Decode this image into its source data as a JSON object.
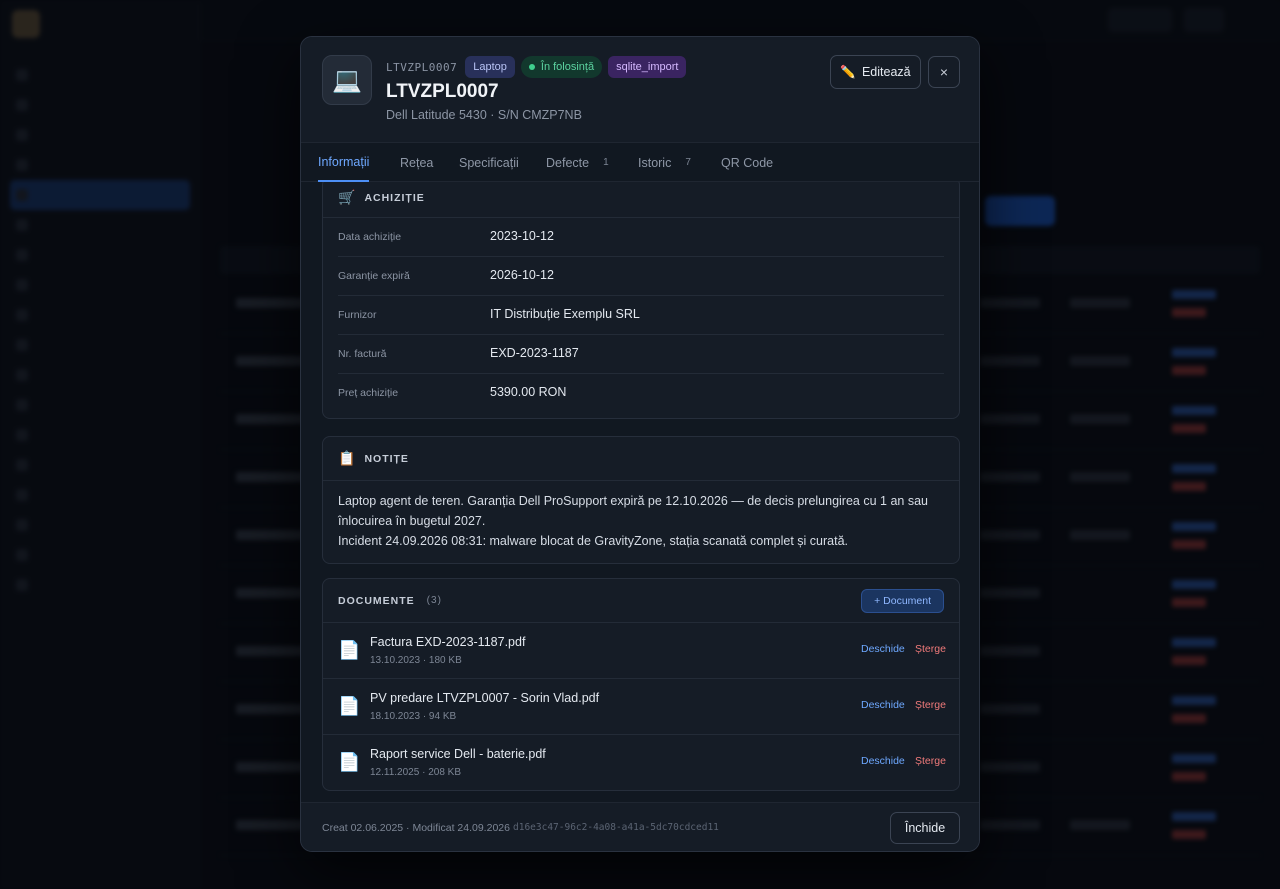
{
  "modal": {
    "device_icon": "laptop-icon",
    "asset_code": "LTVZPL0007",
    "badges": {
      "type": "Laptop",
      "status": "În folosință",
      "source": "sqlite_import"
    },
    "title": "LTVZPL0007",
    "subtitle": "Dell Latitude 5430 · S/N CMZP7NB",
    "edit_label": "Editează",
    "edit_icon": "pencil-icon",
    "close_glyph": "×"
  },
  "tabs": [
    {
      "label": "Informații",
      "active": true
    },
    {
      "label": "Rețea"
    },
    {
      "label": "Specificații"
    },
    {
      "label": "Defecte",
      "count": "1"
    },
    {
      "label": "Istoric",
      "count": "7"
    },
    {
      "label": "QR Code"
    }
  ],
  "acquisition": {
    "icon": "cart-icon",
    "title": "ACHIZIȚIE",
    "rows": [
      {
        "label": "Data achiziție",
        "value": "2023-10-12"
      },
      {
        "label": "Garanție expiră",
        "value": "2026-10-12"
      },
      {
        "label": "Furnizor",
        "value": "IT Distribuție Exemplu SRL"
      },
      {
        "label": "Nr. factură",
        "value": "EXD-2023-1187"
      },
      {
        "label": "Preț achiziție",
        "value": "5390.00 RON"
      }
    ]
  },
  "notes": {
    "icon": "clipboard-icon",
    "title": "NOTIȚE",
    "line1": "Laptop agent de teren. Garanția Dell ProSupport expiră pe 12.10.2026 — de decis prelungirea cu 1 an sau înlocuirea în bugetul 2027.",
    "line2": "Incident 24.09.2026 08:31: malware blocat de GravityZone, stația scanată complet și curată."
  },
  "documents": {
    "title": "DOCUMENTE",
    "count": "(3)",
    "add_label": "+ Document",
    "open_label": "Deschide",
    "delete_label": "Șterge",
    "items": [
      {
        "name": "Factura EXD-2023-1187.pdf",
        "meta": "13.10.2023 · 180 KB"
      },
      {
        "name": "PV predare LTVZPL0007 - Sorin Vlad.pdf",
        "meta": "18.10.2023 · 94 KB"
      },
      {
        "name": "Raport service Dell - baterie.pdf",
        "meta": "12.11.2025 · 208 KB"
      }
    ]
  },
  "footer": {
    "meta": "Creat 02.06.2025 · Modificat 24.09.2026",
    "uuid": "d16e3c47-96c2-4a08-a41a-5dc70cdced11",
    "close_label": "Închide"
  },
  "colors": {
    "accent": "#4d8ff5",
    "status_green": "#3fcf8e",
    "danger": "#f07a7a",
    "modal_bg": "#111821"
  }
}
